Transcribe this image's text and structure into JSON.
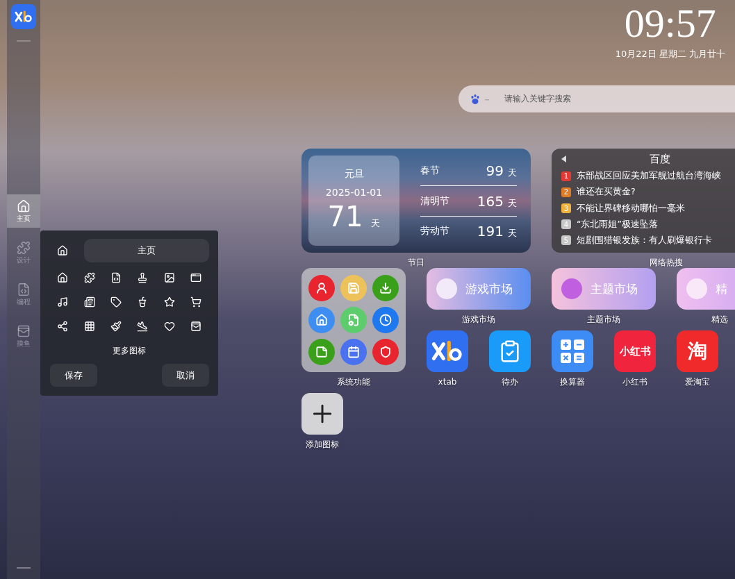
{
  "sidebar": {
    "items": [
      {
        "label": "主页",
        "selected": true
      },
      {
        "label": "设计",
        "selected": false
      },
      {
        "label": "编程",
        "selected": false
      },
      {
        "label": "摸鱼",
        "selected": false
      }
    ]
  },
  "editor": {
    "name_value": "主页",
    "more_icons": "更多图标",
    "buttons": [
      "保存",
      "取消"
    ]
  },
  "clock": {
    "time": "09:57",
    "date": "10月22日 星期二 九月廿十"
  },
  "search": {
    "placeholder": "请输入关键字搜索"
  },
  "holiday_widget": {
    "label": "节日",
    "featured": {
      "name": "元旦",
      "date": "2025-01-01",
      "days": "71",
      "unit": "天"
    },
    "list": [
      {
        "name": "春节",
        "days": "99",
        "unit": "天"
      },
      {
        "name": "清明节",
        "days": "165",
        "unit": "天"
      },
      {
        "name": "劳动节",
        "days": "191",
        "unit": "天"
      }
    ]
  },
  "hot_search": {
    "title": "百度",
    "label": "网络热搜",
    "items": [
      {
        "rank": "1",
        "text": "东部战区回应美加军舰过航台湾海峡",
        "color": "#e53935"
      },
      {
        "rank": "2",
        "text": "谁还在买黄金?",
        "color": "#e07b26"
      },
      {
        "rank": "3",
        "text": "不能让界碑移动哪怕一毫米",
        "color": "#f0b23a"
      },
      {
        "rank": "4",
        "text": "“东北雨姐”极速坠落",
        "color": "#c8c8c8"
      },
      {
        "rank": "5",
        "text": "短剧围猎银发族：有人刷爆银行卡",
        "color": "#c8c8c8"
      }
    ]
  },
  "apps": [
    {
      "kind": "folder",
      "label": "系统功能"
    },
    {
      "kind": "banner",
      "title": "游戏市场",
      "label": "游戏市场"
    },
    {
      "kind": "banner",
      "title": "主题市场",
      "label": "主题市场"
    },
    {
      "kind": "banner",
      "title": "精",
      "label": "精选"
    },
    {
      "kind": "xtab",
      "label": "xtab",
      "color": "#2f6ff0"
    },
    {
      "kind": "todo",
      "label": "待办",
      "color": "#1a9bfa"
    },
    {
      "kind": "calculator",
      "label": "换算器",
      "color": "#3d8cf5"
    },
    {
      "kind": "glyph",
      "glyph": "小红书",
      "label": "小红书",
      "color": "#f0243c"
    },
    {
      "kind": "glyph",
      "glyph": "淘",
      "label": "爱淘宝",
      "color": "#f02a2a"
    },
    {
      "kind": "add",
      "label": "添加图标"
    }
  ]
}
